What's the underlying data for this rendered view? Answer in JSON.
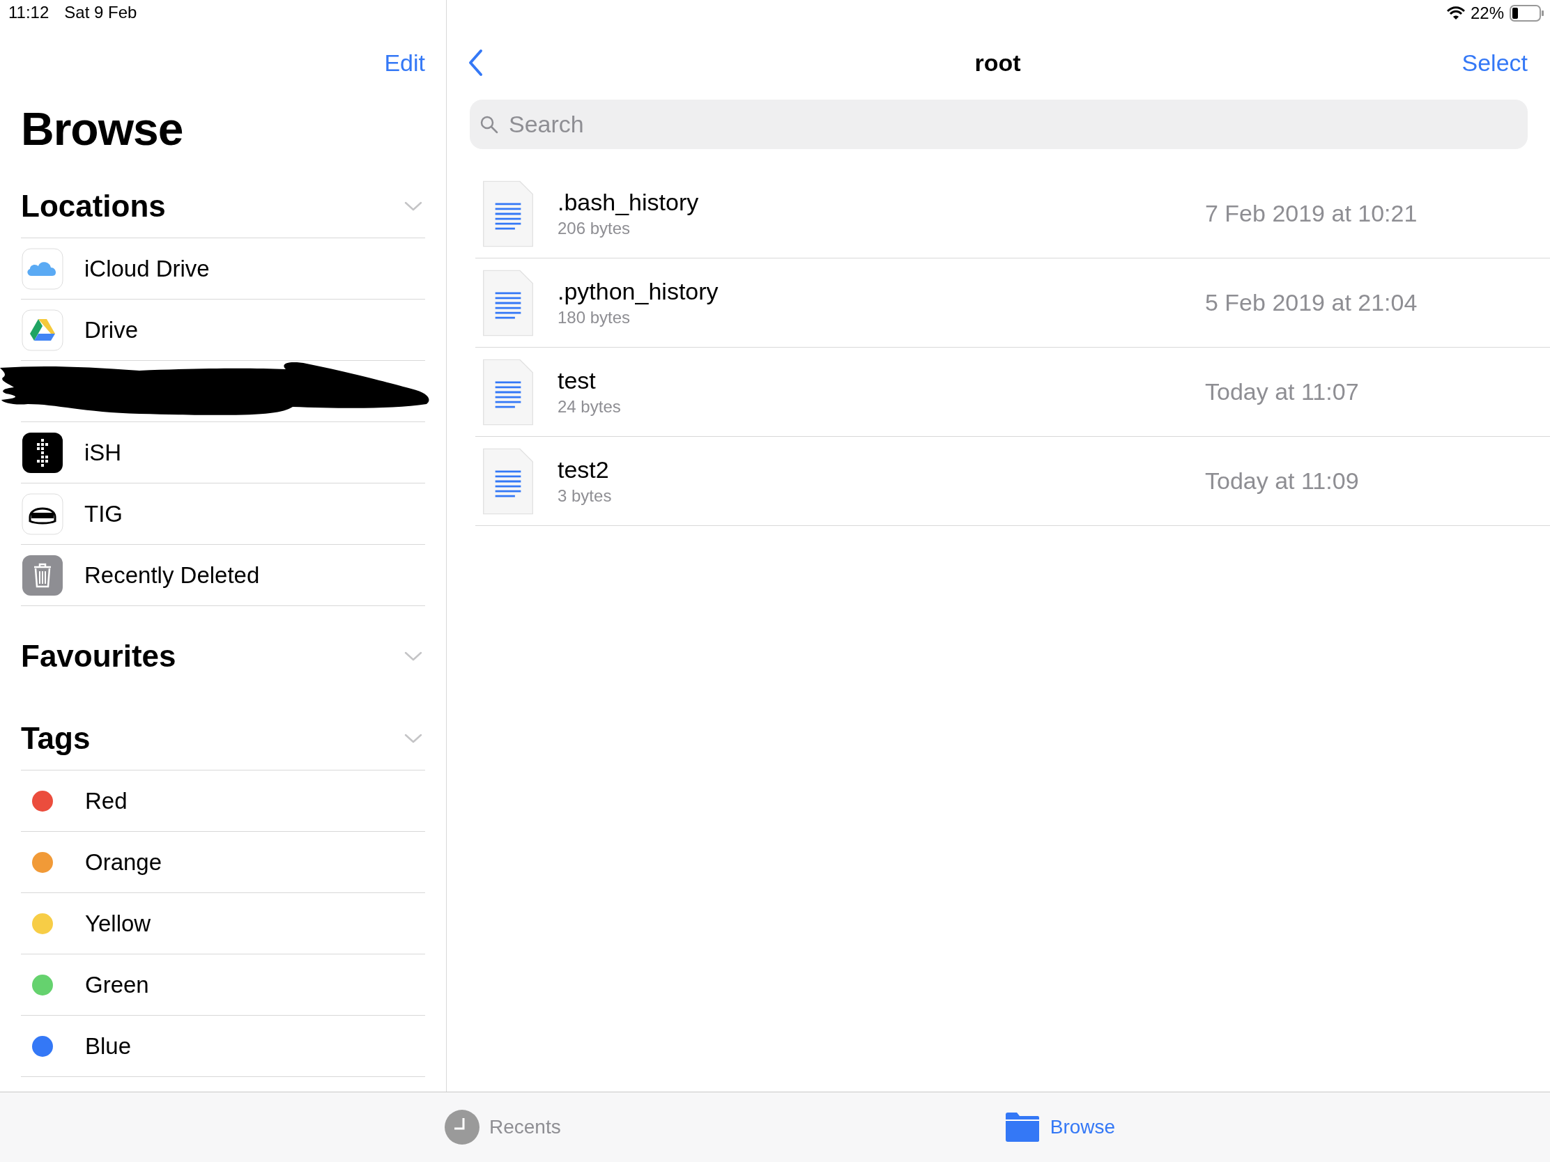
{
  "status_bar": {
    "time": "11:12",
    "date": "Sat 9 Feb",
    "battery_text": "22%"
  },
  "sidebar": {
    "edit": "Edit",
    "title": "Browse",
    "sections": [
      {
        "title": "Locations",
        "expanded": true,
        "items": [
          {
            "kind": "location",
            "label": "iCloud Drive"
          },
          {
            "kind": "location",
            "label": "Drive"
          },
          {
            "kind": "redacted"
          },
          {
            "kind": "location",
            "label": "iSH"
          },
          {
            "kind": "location",
            "label": "TIG"
          },
          {
            "kind": "location",
            "label": "Recently Deleted"
          }
        ]
      },
      {
        "title": "Favourites",
        "expanded": true
      },
      {
        "title": "Tags",
        "expanded": true,
        "items": [
          {
            "kind": "tag",
            "label": "Red",
            "color": "#eb4d3d"
          },
          {
            "kind": "tag",
            "label": "Orange",
            "color": "#f19a37"
          },
          {
            "kind": "tag",
            "label": "Yellow",
            "color": "#f7cd46"
          },
          {
            "kind": "tag",
            "label": "Green",
            "color": "#65d26e"
          },
          {
            "kind": "tag",
            "label": "Blue",
            "color": "#3478f6"
          }
        ]
      }
    ]
  },
  "content": {
    "title": "root",
    "select": "Select",
    "search": {
      "placeholder": "Search"
    },
    "files": [
      {
        "name": ".bash_history",
        "size": "206 bytes",
        "date": "7 Feb 2019 at 10:21"
      },
      {
        "name": ".python_history",
        "size": "180 bytes",
        "date": "5 Feb 2019 at 21:04"
      },
      {
        "name": "test",
        "size": "24 bytes",
        "date": "Today at 11:07"
      },
      {
        "name": "test2",
        "size": "3 bytes",
        "date": "Today at 11:09"
      }
    ]
  },
  "tab_bar": [
    {
      "label": "Recents",
      "selected": false
    },
    {
      "label": "Browse",
      "selected": true
    }
  ]
}
